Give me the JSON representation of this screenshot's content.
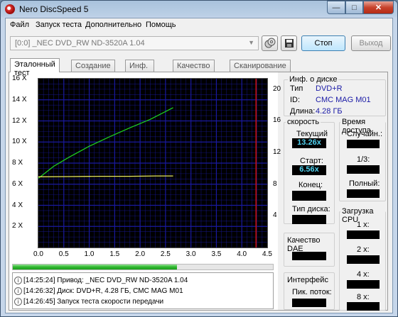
{
  "window": {
    "title": "Nero DiscSpeed 5",
    "min_glyph": "—",
    "max_glyph": "□",
    "close_glyph": "✕"
  },
  "menu": [
    "Файл",
    "Запуск теста",
    "Дополнительно",
    "Помощь"
  ],
  "toolbar": {
    "drive": "[0:0]   _NEC DVD_RW ND-3520A 1.04",
    "stop_label": "Стоп",
    "exit_label": "Выход"
  },
  "tabs": [
    "Эталонный тест",
    "Создание диска",
    "Инф. о диске",
    "Качество диска",
    "Сканирование диска"
  ],
  "chart_data": {
    "type": "line",
    "x_ticks": [
      "0.0",
      "0.5",
      "1.0",
      "1.5",
      "2.0",
      "2.5",
      "3.0",
      "3.5",
      "4.0",
      "4.5"
    ],
    "y_left_ticks": [
      "2 X",
      "4 X",
      "6 X",
      "8 X",
      "10 X",
      "12 X",
      "14 X",
      "16 X"
    ],
    "y_right_ticks": [
      "4",
      "8",
      "12",
      "16",
      "20"
    ],
    "xlim": [
      0,
      4.5
    ],
    "ylim": [
      0,
      16
    ],
    "y_right_lim": [
      0,
      21.33
    ],
    "grid": true,
    "background": "#000000",
    "grid_color": "#1a1aa0",
    "marker": {
      "x": 4.28,
      "color": "#d01010"
    },
    "series": [
      {
        "color": "#1fd01f",
        "x": [
          0,
          0.3,
          0.6,
          1.0,
          1.4,
          1.8,
          2.2,
          2.65
        ],
        "y": [
          6.56,
          7.7,
          8.55,
          9.6,
          10.5,
          11.35,
          12.15,
          13.26
        ]
      },
      {
        "color": "#e8e85a",
        "x": [
          0,
          0.6,
          1.2,
          1.8,
          2.3,
          2.65
        ],
        "y": [
          6.7,
          6.72,
          6.75,
          6.75,
          6.78,
          6.78
        ]
      }
    ]
  },
  "progress": {
    "value": 0.63,
    "color": "#2fb62f"
  },
  "log": [
    {
      "time": "[14:25:24]",
      "text": "Привод: _NEC    DVD_RW ND-3520A  1.04"
    },
    {
      "time": "[14:26:32]",
      "text": "Диск: DVD+R, 4.28 ГБ, CMC MAG M01"
    },
    {
      "time": "[14:26:45]",
      "text": "Запуск теста скорости передачи"
    }
  ],
  "disc_info": {
    "title": "Инф. о диске",
    "type_label": "Тип",
    "type_value": "DVD+R",
    "id_label": "ID:",
    "id_value": "CMC MAG M01",
    "length_label": "Длина:",
    "length_value": "4.28 ГБ"
  },
  "speed": {
    "title": "скорость",
    "current_label": "Текущий",
    "current_value": "13.26x",
    "start_label": "Старт:",
    "start_value": "6.56x",
    "end_label": "Конец:",
    "end_value": "",
    "disc_type_label": "Тип диска:",
    "disc_type_value": ""
  },
  "access": {
    "title": "Время доступа",
    "random_label": "Случайн.:",
    "third_label": "1/3:",
    "full_label": "Полный:"
  },
  "cpu": {
    "title": "Загрузка CPU",
    "labels": [
      "1 x:",
      "2 x:",
      "4 x:",
      "8 x:"
    ]
  },
  "dae": {
    "title": "Качество DAE"
  },
  "interface": {
    "title": "Интерфейс",
    "burst_label": "Пик. поток:"
  }
}
